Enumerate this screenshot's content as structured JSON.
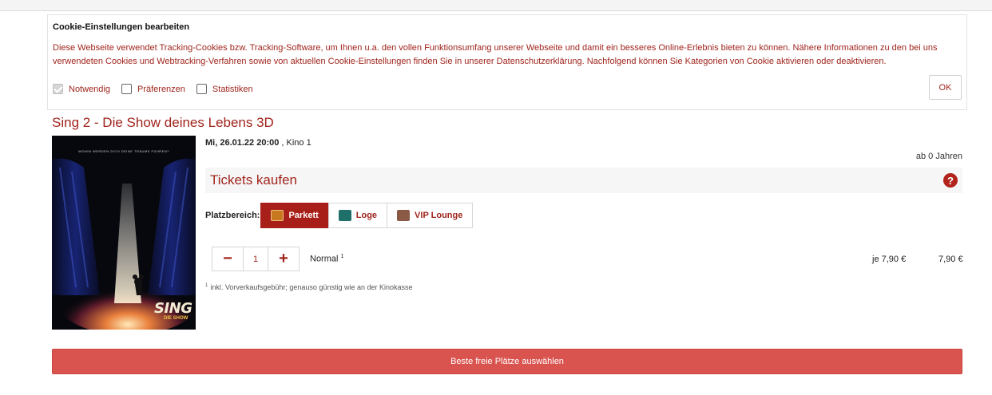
{
  "cookie": {
    "title": "Cookie-Einstellungen bearbeiten",
    "text": "Diese Webseite verwendet Tracking-Cookies bzw. Tracking-Software, um Ihnen u.a. den vollen Funktionsumfang unserer Webseite und damit ein besseres Online-Erlebnis bieten zu können. Nähere Informationen zu den bei uns verwendeten Cookies und Webtracking-Verfahren sowie von aktuellen Cookie-Einstellungen finden Sie in unserer Datenschutzerklärung. Nachfolgend können Sie Kategorien von Cookie aktivieren oder deaktivieren.",
    "options": [
      {
        "label": "Notwendig",
        "checked": true
      },
      {
        "label": "Präferenzen",
        "checked": false
      },
      {
        "label": "Statistiken",
        "checked": false
      }
    ],
    "ok_label": "OK"
  },
  "movie": {
    "title": "Sing 2 - Die Show deines Lebens 3D",
    "poster_tagline": "WOHIN WERDEN DICH DEINE TRÄUME FÜHREN?",
    "poster_logo": "SING",
    "poster_logo_sub": "DIE SHOW",
    "showtime_date": "Mi, 26.01.22 20:00",
    "showtime_room": " , Kino 1",
    "age": "ab 0 Jahren"
  },
  "tickets": {
    "title": "Tickets kaufen",
    "help_icon": "?",
    "area_label": "Platzbereich:",
    "areas": [
      {
        "label": "Parkett",
        "color": "#c8791f",
        "active": true
      },
      {
        "label": "Loge",
        "color": "#1f6f6a",
        "active": false
      },
      {
        "label": "VIP Lounge",
        "color": "#8a5a46",
        "active": false
      }
    ],
    "minus_label": "−",
    "quantity": "1",
    "plus_label": "+",
    "type": "Normal",
    "type_note": "1",
    "unit_price": "je 7,90 €",
    "total_price": "7,90 €",
    "footnote_mark": "1",
    "footnote": "inkl. Vorverkaufsgebühr; genauso günstig wie an der Kinokasse"
  },
  "best_seats_label": "Beste freie Plätze auswählen",
  "colors": {
    "accent": "#a0251d",
    "button": "#d9534f"
  }
}
